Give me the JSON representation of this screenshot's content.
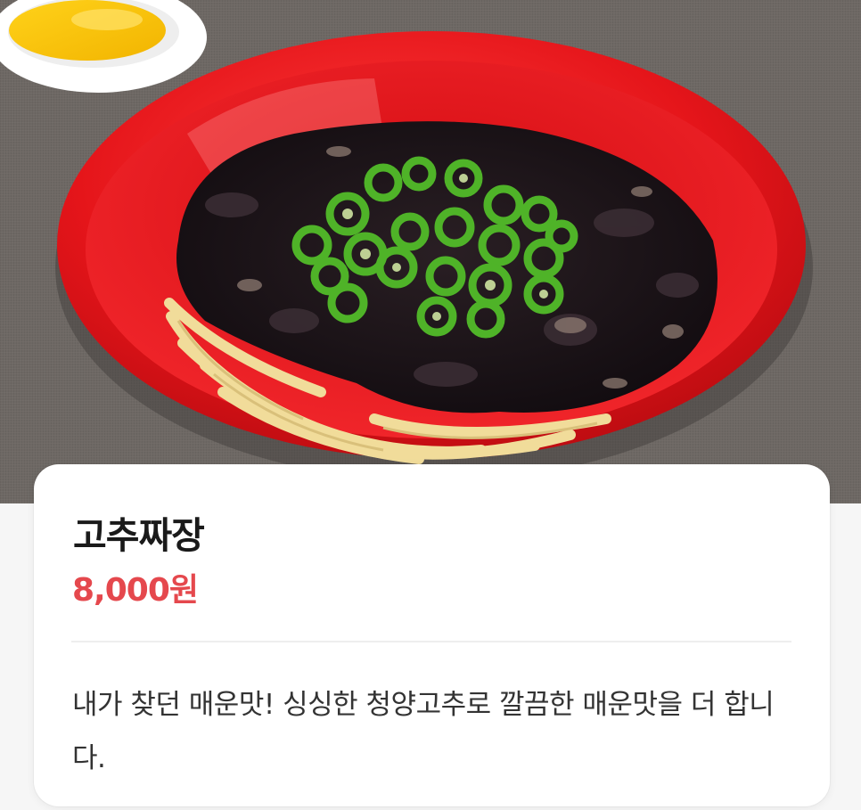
{
  "product": {
    "name": "고추짜장",
    "price": "8,000원",
    "description": "내가 찾던 매운맛! 싱싱한 청양고추로 깔끔한 매운맛을 더 합니다."
  },
  "image": {
    "subject": "jjajang-noodles-with-green-chili",
    "icon": "food-photo"
  },
  "colors": {
    "price": "#e5484d",
    "bowl": "#e8161b",
    "card": "#ffffff"
  }
}
